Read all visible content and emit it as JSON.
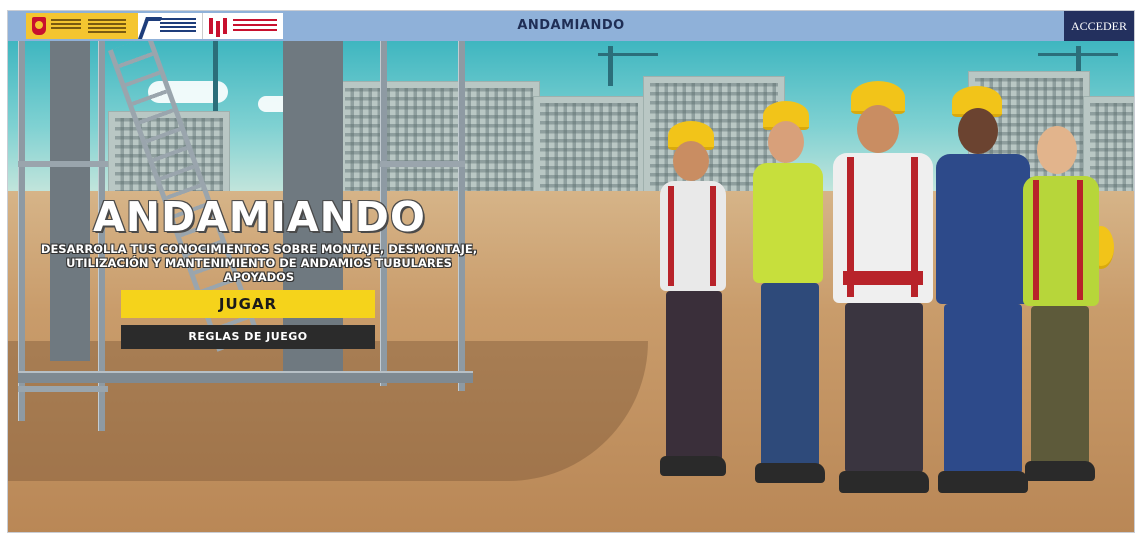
{
  "header": {
    "title": "ANDAMIANDO",
    "login_label": "ACCEDER",
    "logos": [
      "gobierno-de-espana-logo",
      "fundacion-prevencion-riesgos-laborales-logo",
      "fundacion-laboral-construccion-logo"
    ]
  },
  "hero": {
    "title": "ANDAMIANDO",
    "subtitle": "DESARROLLA TUS CONOCIMIENTOS SOBRE MONTAJE, DESMONTAJE, UTILIZACIÓN Y MANTENIMIENTO DE ANDAMIOS TUBULARES APOYADOS",
    "play_label": "JUGAR",
    "rules_label": "REGLAS DE JUEGO"
  },
  "colors": {
    "header_bar": "#8fb1d9",
    "login_button": "#23305e",
    "play_button": "#f5d31b",
    "rules_button": "#2b2b2b"
  }
}
